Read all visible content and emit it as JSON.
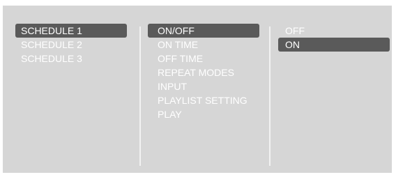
{
  "schedules": {
    "items": [
      {
        "label": "SCHEDULE 1",
        "selected": true
      },
      {
        "label": "SCHEDULE 2",
        "selected": false
      },
      {
        "label": "SCHEDULE 3",
        "selected": false
      }
    ]
  },
  "settings": {
    "items": [
      {
        "label": "ON/OFF",
        "selected": true
      },
      {
        "label": "ON TIME",
        "selected": false
      },
      {
        "label": "OFF TIME",
        "selected": false
      },
      {
        "label": "REPEAT MODES",
        "selected": false
      },
      {
        "label": "INPUT",
        "selected": false
      },
      {
        "label": "PLAYLIST SETTING",
        "selected": false
      },
      {
        "label": "PLAY",
        "selected": false
      }
    ]
  },
  "options": {
    "items": [
      {
        "label": "OFF",
        "selected": false
      },
      {
        "label": "ON",
        "selected": true
      }
    ]
  },
  "colors": {
    "panel_background": "#d6d6d6",
    "highlight": "#5a5a5a",
    "text": "#ffffff"
  }
}
